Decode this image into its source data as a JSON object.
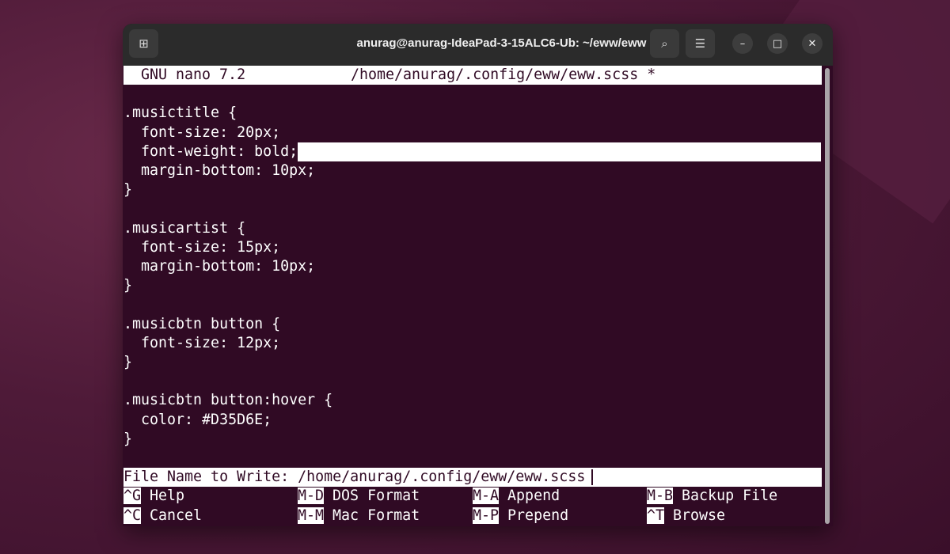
{
  "window": {
    "title": "anurag@anurag-IdeaPad-3-15ALC6-Ub: ~/eww/eww"
  },
  "nano": {
    "version": "GNU nano 7.2",
    "file": "/home/anurag/.config/eww/eww.scss *"
  },
  "lines": [
    "",
    ".musictitle {",
    "  font-size: 20px;",
    "  font-weight: bold;",
    "  margin-bottom: 10px;",
    "}",
    "",
    ".musicartist {",
    "  font-size: 15px;",
    "  margin-bottom: 10px;",
    "}",
    "",
    ".musicbtn button {",
    "  font-size: 12px;",
    "}",
    "",
    ".musicbtn button:hover {",
    "  color: #D35D6E;",
    "}"
  ],
  "prompt": {
    "label": "File Name to Write: ",
    "value": "/home/anurag/.config/eww/eww.scss"
  },
  "shortcuts": [
    [
      {
        "key": "^G",
        "label": "Help"
      },
      {
        "key": "M-D",
        "label": "DOS Format"
      },
      {
        "key": "M-A",
        "label": "Append"
      },
      {
        "key": "M-B",
        "label": "Backup File"
      }
    ],
    [
      {
        "key": "^C",
        "label": "Cancel"
      },
      {
        "key": "M-M",
        "label": "Mac Format"
      },
      {
        "key": "M-P",
        "label": "Prepend"
      },
      {
        "key": "^T",
        "label": "Browse"
      }
    ]
  ],
  "colors": {
    "terminal_bg": "#300a24",
    "titlebar": "#2b2b2b"
  }
}
